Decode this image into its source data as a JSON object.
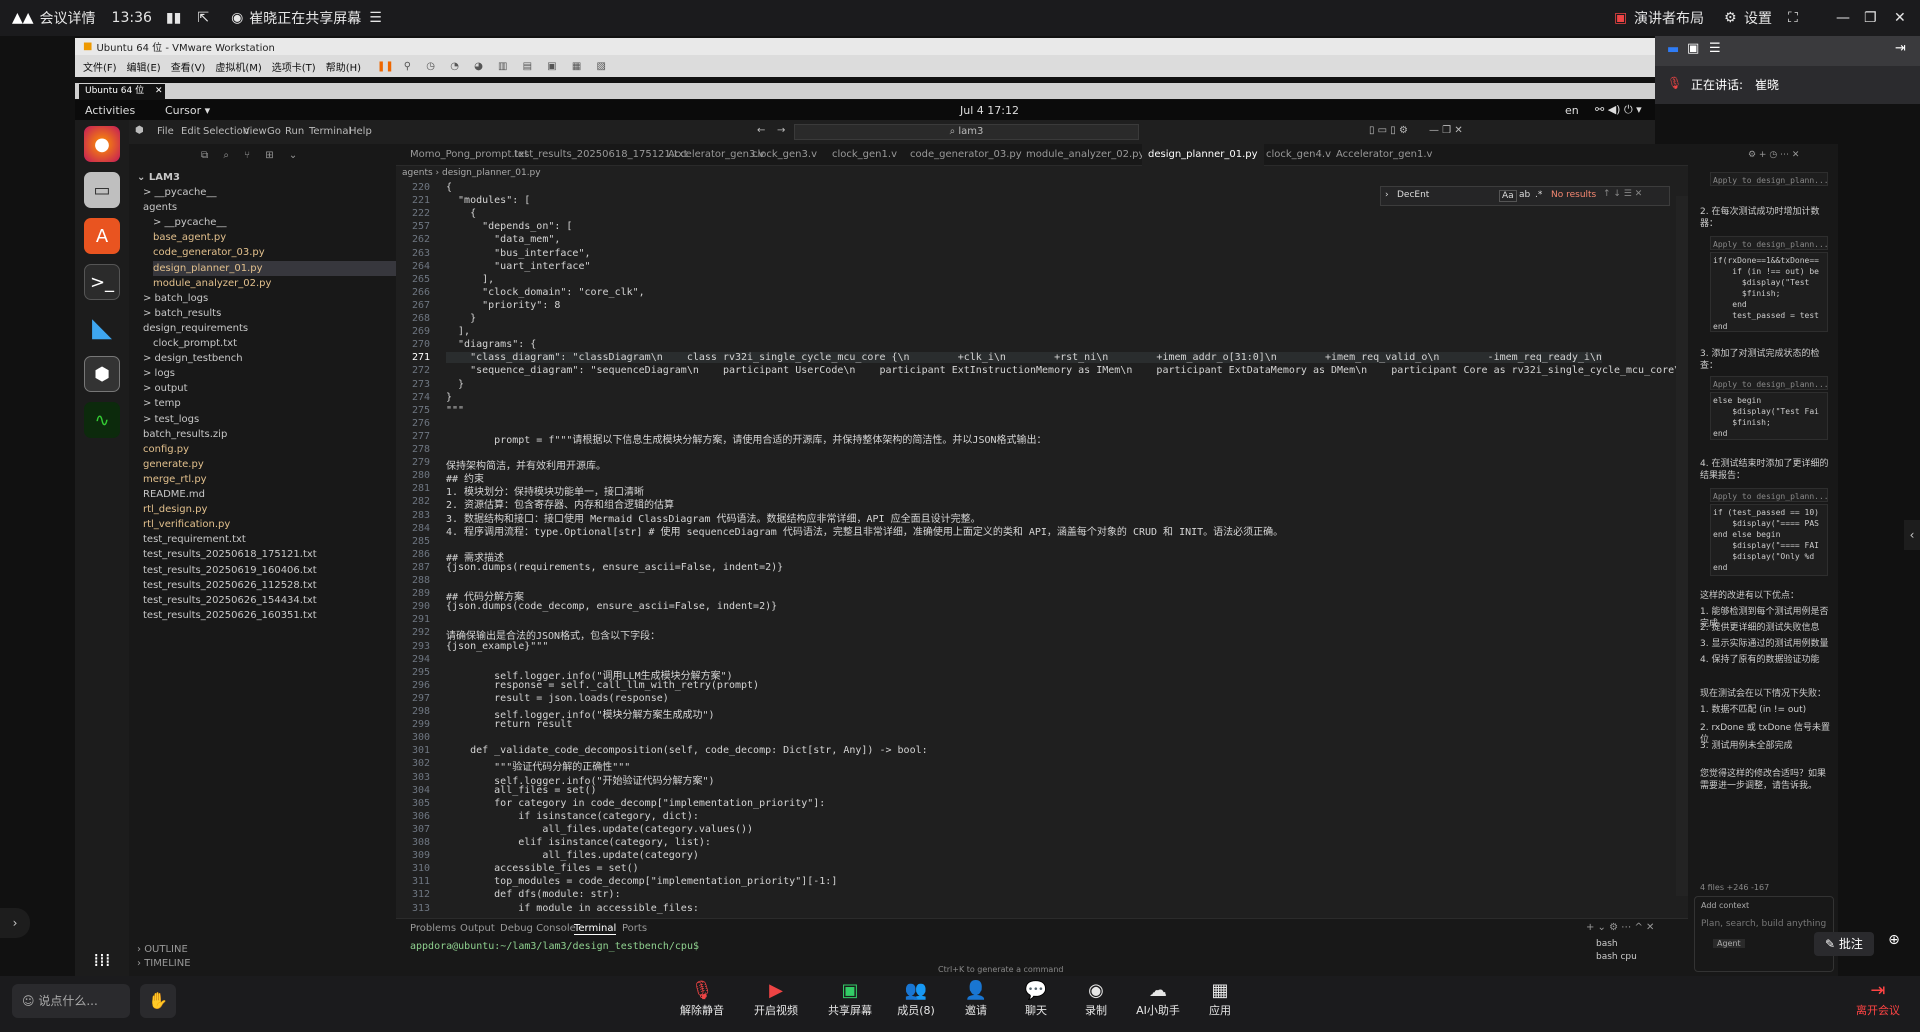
{
  "meeting_top": {
    "title": "会议详情",
    "time": "13:36",
    "sharing": "崔晓正在共享屏幕",
    "layout": "演讲者布局",
    "settings": "设置"
  },
  "speaking": {
    "label": "正在讲话:",
    "name": "崔晓"
  },
  "vmware": {
    "title": "Ubuntu 64 位 - VMware Workstation",
    "menu": [
      "文件(F)",
      "编辑(E)",
      "查看(V)",
      "虚拟机(M)",
      "选项卡(T)",
      "帮助(H)"
    ],
    "tab": "Ubuntu 64 位"
  },
  "ubuntu": {
    "activities": "Activities",
    "app": "Cursor",
    "clock": "Jul 4  17:12",
    "lang": "en"
  },
  "cursor": {
    "menu": [
      "File",
      "Edit",
      "Selection",
      "View",
      "Go",
      "Run",
      "Terminal",
      "Help"
    ],
    "search": "lam3",
    "breadcrumb": [
      "agents",
      "design_planner_01.py"
    ]
  },
  "explorer": {
    "root": "LAM3",
    "rows": [
      {
        "t": "> __pycache__",
        "d": 1
      },
      {
        "t": "agents",
        "d": 1
      },
      {
        "t": "> __pycache__",
        "d": 2
      },
      {
        "t": "base_agent.py",
        "d": 2
      },
      {
        "t": "code_generator_03.py",
        "d": 2
      },
      {
        "t": "design_planner_01.py",
        "d": 2,
        "sel": true
      },
      {
        "t": "module_analyzer_02.py",
        "d": 2
      },
      {
        "t": "> batch_logs",
        "d": 1
      },
      {
        "t": "> batch_results",
        "d": 1
      },
      {
        "t": "design_requirements",
        "d": 1
      },
      {
        "t": "clock_prompt.txt",
        "d": 2
      },
      {
        "t": "> design_testbench",
        "d": 1
      },
      {
        "t": "> logs",
        "d": 1
      },
      {
        "t": "> output",
        "d": 1
      },
      {
        "t": "> temp",
        "d": 1
      },
      {
        "t": "> test_logs",
        "d": 1
      },
      {
        "t": "batch_results.zip",
        "d": 1
      },
      {
        "t": "config.py",
        "d": 1
      },
      {
        "t": "generate.py",
        "d": 1
      },
      {
        "t": "merge_rtl.py",
        "d": 1
      },
      {
        "t": "README.md",
        "d": 1
      },
      {
        "t": "rtl_design.py",
        "d": 1
      },
      {
        "t": "rtl_verification.py",
        "d": 1
      },
      {
        "t": "test_requirement.txt",
        "d": 1
      },
      {
        "t": "test_results_20250618_175121.txt",
        "d": 1
      },
      {
        "t": "test_results_20250619_160406.txt",
        "d": 1
      },
      {
        "t": "test_results_20250626_112528.txt",
        "d": 1
      },
      {
        "t": "test_results_20250626_154434.txt",
        "d": 1
      },
      {
        "t": "test_results_20250626_160351.txt",
        "d": 1
      }
    ],
    "outline": "OUTLINE",
    "timeline": "TIMELINE"
  },
  "tabs": [
    "Momo_Pong_prompt.txt",
    "test_results_20250618_175121.txt",
    "Accelerator_gen3.v",
    "clock_gen3.v",
    "clock_gen1.v",
    "code_generator_03.py",
    "module_analyzer_02.py",
    "design_planner_01.py",
    "clock_gen4.v",
    "Accelerator_gen1.v"
  ],
  "find": {
    "value": "DecEnt",
    "result": "No results"
  },
  "code": [
    {
      "n": "220",
      "t": "{",
      "c": ""
    },
    {
      "n": "221",
      "t": "  \"modules\": [",
      "c": "str"
    },
    {
      "n": "222",
      "t": "    {",
      "c": ""
    },
    {
      "n": "257",
      "t": "      \"depends_on\": [",
      "c": "str"
    },
    {
      "n": "262",
      "t": "        \"data_mem\",",
      "c": "str"
    },
    {
      "n": "263",
      "t": "        \"bus_interface\",",
      "c": "str"
    },
    {
      "n": "264",
      "t": "        \"uart_interface\"",
      "c": "str"
    },
    {
      "n": "265",
      "t": "      ],",
      "c": ""
    },
    {
      "n": "266",
      "t": "      \"clock_domain\": \"core_clk\",",
      "c": "str"
    },
    {
      "n": "267",
      "t": "      \"priority\": 8",
      "c": "str"
    },
    {
      "n": "268",
      "t": "    }",
      "c": ""
    },
    {
      "n": "269",
      "t": "  ],",
      "c": ""
    },
    {
      "n": "270",
      "t": "  \"diagrams\": {",
      "c": "str"
    },
    {
      "n": "271",
      "t": "    \"class_diagram\": \"classDiagram\\n    class rv32i_single_cycle_mcu_core {\\n        +clk_i\\n        +rst_ni\\n        +imem_addr_o[31:0]\\n        +imem_req_valid_o\\n        -imem_req_ready_i\\n",
      "c": "str"
    },
    {
      "n": "272",
      "t": "    \"sequence_diagram\": \"sequenceDiagram\\n    participant UserCode\\n    participant ExtInstructionMemory as IMem\\n    participant ExtDataMemory as DMem\\n    participant Core as rv32i_single_cycle_mcu_core\\n",
      "c": "str"
    },
    {
      "n": "273",
      "t": "  }",
      "c": ""
    },
    {
      "n": "274",
      "t": "}",
      "c": ""
    },
    {
      "n": "275",
      "t": "\"\"\"",
      "c": "str"
    },
    {
      "n": "276",
      "t": "",
      "c": ""
    },
    {
      "n": "277",
      "t": "        prompt = f\"\"\"请根据以下信息生成模块分解方案，请使用合适的开源库，并保持整体架构的简洁性。并以JSON格式输出：",
      "c": "str"
    },
    {
      "n": "278",
      "t": "",
      "c": ""
    },
    {
      "n": "279",
      "t": "保持架构简洁，并有效利用开源库。",
      "c": "str"
    },
    {
      "n": "280",
      "t": "## 约束",
      "c": "str"
    },
    {
      "n": "281",
      "t": "1. 模块划分：保持模块功能单一，接口清晰",
      "c": "str"
    },
    {
      "n": "282",
      "t": "2. 资源估算：包含寄存器、内存和组合逻辑的估算",
      "c": "str"
    },
    {
      "n": "283",
      "t": "3. 数据结构和接口：接口使用 Mermaid ClassDiagram 代码语法。数据结构应非常详细，API 应全面且设计完整。",
      "c": "str"
    },
    {
      "n": "284",
      "t": "4. 程序调用流程：type.Optional[str] # 使用 sequenceDiagram 代码语法，完整且非常详细，准确使用上面定义的类和 API，涵盖每个对象的 CRUD 和 INIT。语法必须正确。",
      "c": "str"
    },
    {
      "n": "285",
      "t": "",
      "c": ""
    },
    {
      "n": "286",
      "t": "## 需求描述",
      "c": "str"
    },
    {
      "n": "287",
      "t": "{json.dumps(requirements, ensure_ascii=False, indent=2)}",
      "c": ""
    },
    {
      "n": "288",
      "t": "",
      "c": ""
    },
    {
      "n": "289",
      "t": "## 代码分解方案",
      "c": "str"
    },
    {
      "n": "290",
      "t": "{json.dumps(code_decomp, ensure_ascii=False, indent=2)}",
      "c": ""
    },
    {
      "n": "291",
      "t": "",
      "c": ""
    },
    {
      "n": "292",
      "t": "请确保输出是合法的JSON格式，包含以下字段：",
      "c": "str"
    },
    {
      "n": "293",
      "t": "{json_example}\"\"\"",
      "c": "str"
    },
    {
      "n": "294",
      "t": "",
      "c": ""
    },
    {
      "n": "295",
      "t": "        self.logger.info(\"调用LLM生成模块分解方案\")",
      "c": ""
    },
    {
      "n": "296",
      "t": "        response = self._call_llm_with_retry(prompt)",
      "c": ""
    },
    {
      "n": "297",
      "t": "        result = json.loads(response)",
      "c": ""
    },
    {
      "n": "298",
      "t": "        self.logger.info(\"模块分解方案生成成功\")",
      "c": ""
    },
    {
      "n": "299",
      "t": "        return result",
      "c": "kw"
    },
    {
      "n": "300",
      "t": "",
      "c": ""
    },
    {
      "n": "301",
      "t": "    def _validate_code_decomposition(self, code_decomp: Dict[str, Any]) -> bool:",
      "c": "fn"
    },
    {
      "n": "302",
      "t": "        \"\"\"验证代码分解的正确性\"\"\"",
      "c": "str"
    },
    {
      "n": "303",
      "t": "        self.logger.info(\"开始验证代码分解方案\")",
      "c": ""
    },
    {
      "n": "304",
      "t": "        all_files = set()",
      "c": ""
    },
    {
      "n": "305",
      "t": "        for category in code_decomp[\"implementation_priority\"]:",
      "c": ""
    },
    {
      "n": "306",
      "t": "            if isinstance(category, dict):",
      "c": ""
    },
    {
      "n": "307",
      "t": "                all_files.update(category.values())",
      "c": ""
    },
    {
      "n": "308",
      "t": "            elif isinstance(category, list):",
      "c": ""
    },
    {
      "n": "309",
      "t": "                all_files.update(category)",
      "c": ""
    },
    {
      "n": "310",
      "t": "        accessible_files = set()",
      "c": ""
    },
    {
      "n": "311",
      "t": "        top_modules = code_decomp[\"implementation_priority\"][-1:]",
      "c": ""
    },
    {
      "n": "312",
      "t": "        def dfs(module: str):",
      "c": "fn"
    },
    {
      "n": "313",
      "t": "            if module in accessible_files:",
      "c": ""
    }
  ],
  "panel": {
    "tabs": [
      "Problems",
      "Output",
      "Debug Console",
      "Terminal",
      "Ports"
    ],
    "prompt": "appdora@ubuntu:~/lam3/lam3/design_testbench/cpu$ ",
    "hint": "Ctrl+K to generate a command",
    "shells": [
      "bash",
      "bash  cpu"
    ]
  },
  "chat": {
    "apply": "Apply to design_plann...",
    "items": [
      "2. 在每次测试成功时增加计数器：",
      "3. 添加了对测试完成状态的检查：",
      "4. 在测试结束时添加了更详细的结果报告："
    ],
    "code1": "if(rxDone==1&&txDone==\n    if (in !== out) be\n      $display(\"Test\n      $finish;\n    end\n    test_passed = test\nend",
    "code2": "else begin\n    $display(\"Test Fai\n    $finish;\nend",
    "code3": "if (test_passed == 10)\n    $display(\"==== PAS\nend else begin\n    $display(\"==== FAI\n    $display(\"Only %d\nend",
    "summary": "这样的改进有以下优点：",
    "pros": [
      "1. 能够检测到每个测试用例是否完成",
      "2. 提供更详细的测试失败信息",
      "3. 显示实际通过的测试用例数量",
      "4. 保持了原有的数据验证功能"
    ],
    "fail_title": "现在测试会在以下情况下失败：",
    "fails": [
      "1. 数据不匹配 (in != out)",
      "2. rxDone 或 txDone 信号未置位",
      "3. 测试用例未全部完成"
    ],
    "ask": "您觉得这样的修改合适吗？如果需要进一步调整，请告诉我。",
    "files": "4 files +246 -167",
    "add_context": "Add context",
    "input_placeholder": "Plan, search, build anything",
    "agent": "Agent"
  },
  "bottombar": {
    "input_placeholder": "说点什么...",
    "buttons": [
      "解除静音",
      "开启视频",
      "共享屏幕",
      "成员(8)",
      "邀请",
      "聊天",
      "录制",
      "AI小助手",
      "应用"
    ],
    "leave": "离开会议",
    "annotate": "批注"
  }
}
